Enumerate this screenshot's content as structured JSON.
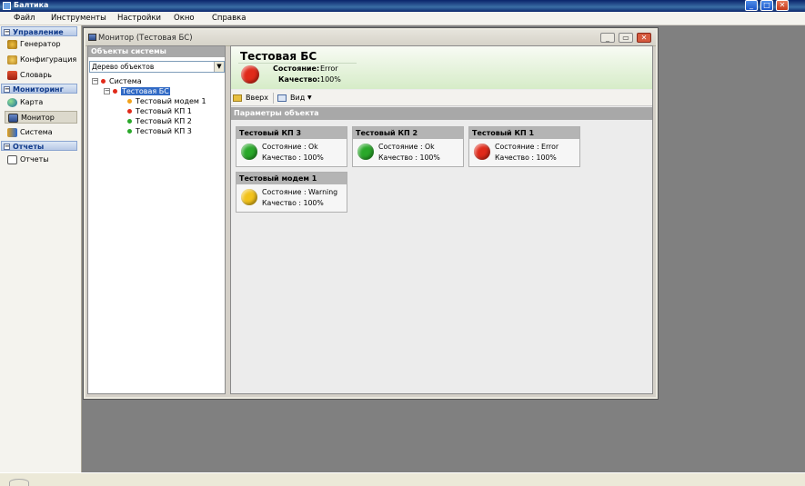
{
  "app": {
    "title": "Балтика"
  },
  "menu": [
    "Файл",
    "Инструменты",
    "Настройки",
    "Окно",
    "Справка"
  ],
  "sidebar": {
    "groups": [
      {
        "label": "Управление",
        "items": [
          {
            "label": "Генератор",
            "icon": "generator-icon"
          },
          {
            "label": "Конфигурация",
            "icon": "config-icon"
          },
          {
            "label": "Словарь",
            "icon": "dictionary-icon"
          }
        ]
      },
      {
        "label": "Мониторинг",
        "items": [
          {
            "label": "Карта",
            "icon": "globe-icon"
          },
          {
            "label": "Монитор",
            "icon": "monitor-icon"
          },
          {
            "label": "Система",
            "icon": "system-icon"
          }
        ]
      },
      {
        "label": "Отчеты",
        "items": [
          {
            "label": "Отчеты",
            "icon": "report-icon"
          }
        ]
      }
    ]
  },
  "child_window": {
    "title": "Монитор (Тестовая БС)",
    "object_panel": {
      "header": "Объекты системы",
      "combo_value": "Дерево объектов",
      "tree": [
        {
          "label": "Система",
          "status": "red"
        },
        {
          "label": "Тестовая БС",
          "status": "red"
        },
        {
          "label": "Тестовый модем 1",
          "status": "yellow"
        },
        {
          "label": "Тестовый КП 1",
          "status": "red"
        },
        {
          "label": "Тестовый КП 2",
          "status": "green"
        },
        {
          "label": "Тестовый КП 3",
          "status": "green"
        }
      ]
    },
    "detail": {
      "title": "Тестовая БС",
      "state_label": "Состояние:",
      "state_value": "Error",
      "quality_label": "Качество:",
      "quality_value": "100%",
      "toolbar": {
        "up": "Вверх",
        "view": "Вид"
      },
      "params_header": "Параметры объекта",
      "cards": [
        {
          "title": "Тестовый КП 3",
          "state": "Состояние : Ok",
          "quality": "Качество : 100%",
          "status": "green"
        },
        {
          "title": "Тестовый КП 2",
          "state": "Состояние : Ok",
          "quality": "Качество : 100%",
          "status": "green"
        },
        {
          "title": "Тестовый КП 1",
          "state": "Состояние : Error",
          "quality": "Качество : 100%",
          "status": "red"
        },
        {
          "title": "Тестовый модем 1",
          "state": "Состояние : Warning",
          "quality": "Качество : 100%",
          "status": "yellow"
        }
      ]
    }
  },
  "colors": {
    "red": "#e02a1a",
    "green": "#2aa82a",
    "yellow": "#f2c21a"
  }
}
